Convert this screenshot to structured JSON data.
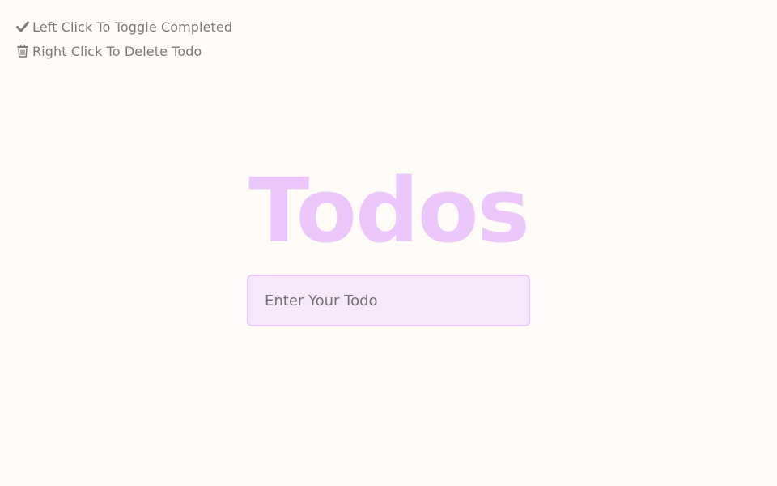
{
  "hints": {
    "toggle": {
      "icon": "check-icon",
      "label": "Left Click To Toggle Completed"
    },
    "delete": {
      "icon": "trash-icon",
      "label": "Right Click To Delete Todo"
    }
  },
  "title": "Todos",
  "input": {
    "placeholder": "Enter Your Todo",
    "value": ""
  },
  "colors": {
    "background": "#fffbf6",
    "title": "#ebc7fb",
    "input_background": "#f8e8fb",
    "input_border": "#ebc7fb",
    "hint_text": "#7a7a7a"
  }
}
